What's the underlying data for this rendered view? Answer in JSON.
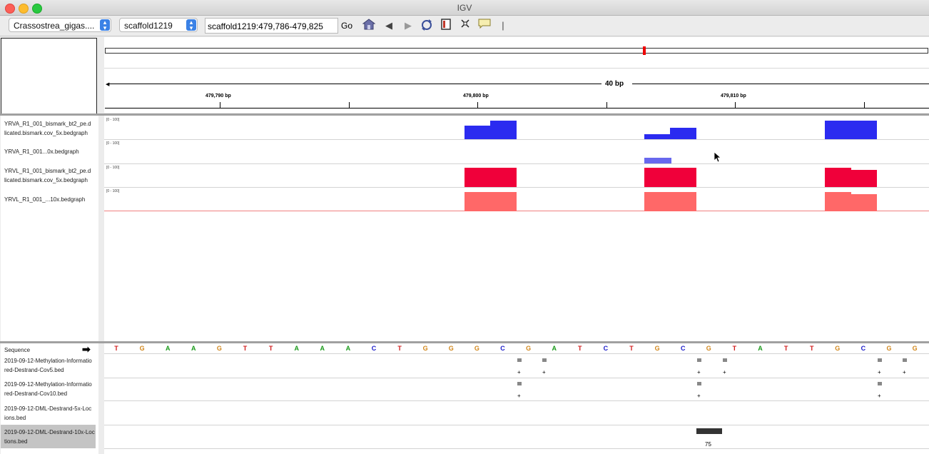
{
  "window": {
    "title": "IGV"
  },
  "toolbar": {
    "genome": "Crassostrea_gigas....",
    "chromosome": "scaffold1219",
    "locus": "scaffold1219:479,786-479,825",
    "go_label": "Go"
  },
  "ruler": {
    "span_label": "40 bp",
    "ticks": [
      "479,790 bp",
      "479,800 bp",
      "479,810 bp"
    ]
  },
  "data_tracks": [
    {
      "label_line1": "YRVA_R1_001_bismark_bt2_pe.d",
      "label_line2": "licated.bismark.cov_5x.bedgraph",
      "range": "[0 - 100]",
      "color": "#2b2bf0"
    },
    {
      "label_line1": "YRVA_R1_001...0x.bedgraph",
      "label_line2": "",
      "range": "[0 - 100]",
      "color": "#6868ee"
    },
    {
      "label_line1": "YRVL_R1_001_bismark_bt2_pe.d",
      "label_line2": "licated.bismark.cov_5x.bedgraph",
      "range": "[0 - 100]",
      "color": "#f0003a"
    },
    {
      "label_line1": "YRVL_R1_001_...10x.bedgraph",
      "label_line2": "",
      "range": "[0 - 100]",
      "color": "#ff6868"
    }
  ],
  "sequence": {
    "label": "Sequence",
    "bases": [
      "T",
      "G",
      "A",
      "A",
      "G",
      "T",
      "T",
      "A",
      "A",
      "A",
      "C",
      "T",
      "G",
      "G",
      "G",
      "C",
      "G",
      "A",
      "T",
      "C",
      "T",
      "G",
      "C",
      "G",
      "T",
      "A",
      "T",
      "T",
      "G",
      "C",
      "G",
      "G"
    ],
    "colors": {
      "A": "#1a9a1a",
      "C": "#1a1ac8",
      "G": "#d1861a",
      "T": "#d11a1a"
    }
  },
  "feature_tracks": [
    {
      "label_line1": "2019-09-12-Methylation-Informatio",
      "label_line2": "red-Destrand-Cov5.bed"
    },
    {
      "label_line1": "2019-09-12-Methylation-Informatio",
      "label_line2": "red-Destrand-Cov10.bed"
    },
    {
      "label_line1": "2019-09-12-DML-Destrand-5x-Loc",
      "label_line2": "ions.bed"
    },
    {
      "label_line1": "2019-09-12-DML-Destrand-10x-Loc",
      "label_line2": "tions.bed",
      "selected": true,
      "feature_score": "75"
    }
  ],
  "feature_strand": "+"
}
